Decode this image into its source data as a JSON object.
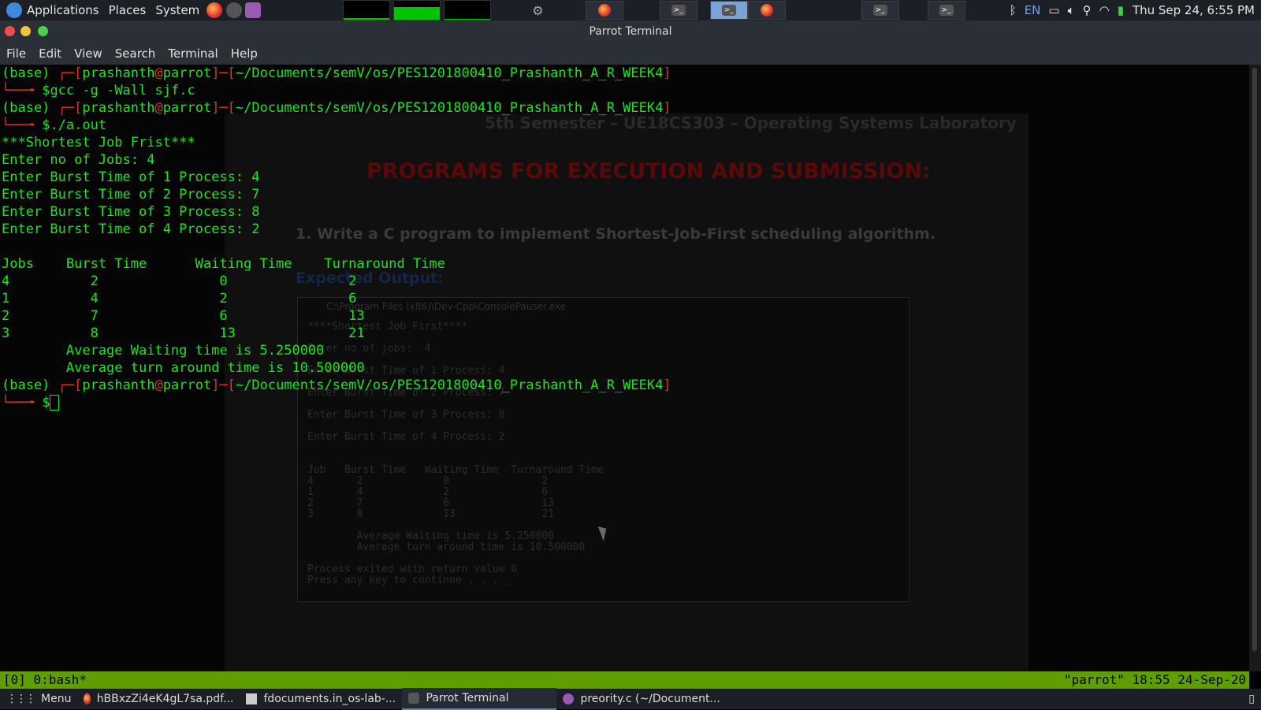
{
  "top_panel": {
    "applications": "Applications",
    "places": "Places",
    "system": "System",
    "keyboard_layout": "EN",
    "datetime": "Thu Sep 24,  6:55 PM"
  },
  "window": {
    "title": "Parrot Terminal"
  },
  "menubar": {
    "file": "File",
    "edit": "Edit",
    "view": "View",
    "search": "Search",
    "terminal": "Terminal",
    "help": "Help"
  },
  "terminal": {
    "prompt_env": "(base)",
    "user": "prashanth",
    "host": "parrot",
    "cwd": "~/Documents/semV/os/PES1201800410_Prashanth_A_R_WEEK4",
    "cmd1": "gcc -g -Wall sjf.c",
    "cmd2": "./a.out",
    "output": [
      "***Shortest Job Frist***",
      "Enter no of Jobs: 4",
      "Enter Burst Time of 1 Process: 4",
      "Enter Burst Time of 2 Process: 7",
      "Enter Burst Time of 3 Process: 8",
      "Enter Burst Time of 4 Process: 2",
      "",
      "Jobs    Burst Time      Waiting Time    Turnaround Time",
      "4          2               0               2",
      "1          4               2               6",
      "2          7               6               13",
      "3          8               13              21",
      "        Average Waiting time is 5.250000",
      "        Average turn around time is 10.500000"
    ]
  },
  "background_doc": {
    "heading_top": "5th Semester – UE18CS303 – Operating Systems Laboratory",
    "heading": "PROGRAMS FOR EXECUTION AND SUBMISSION:",
    "question": "1.  Write a C program to implement Shortest-Job-First scheduling algorithm.",
    "expected": "Expected Output:",
    "console_title": "C:\\Program Files (x86)\\Dev-Cpp\\ConsolePauser.exe",
    "console_lines": [
      "****Shortest Job First****",
      "",
      "Enter no of jobs:  4",
      "",
      "Enter Burst Time of 1 Process: 4",
      "",
      "Enter Burst Time of 2 Process: 7",
      "",
      "Enter Burst Time of 3 Process: 8",
      "",
      "Enter Burst Time of 4 Process: 2",
      "",
      "",
      "Job   Burst Time   Waiting Time  Turnaround Time",
      "4       2             0               2",
      "1       4             2               6",
      "2       7             6               13",
      "3       8             13              21",
      "",
      "        Average Waiting time is 5.250000",
      "        Average turn around time is 10.500000",
      "",
      "Process exited with return value 0",
      "Press any key to continue . . . _"
    ]
  },
  "tmux": {
    "left": "[0] 0:bash*",
    "right": "\"parrot\" 18:55 24-Sep-20"
  },
  "taskbar": {
    "menu": "Menu",
    "items": [
      "hBBxzZi4eK4gL7sa.pdf...",
      "fdocuments.in_os-lab-...",
      "Parrot Terminal",
      "preority.c (~/Document..."
    ]
  },
  "colors": {
    "terminal_green": "#19e619",
    "prompt_red": "#e0302a",
    "tmux_bar": "#5f9e00",
    "panel_bg": "#1c1f26"
  }
}
